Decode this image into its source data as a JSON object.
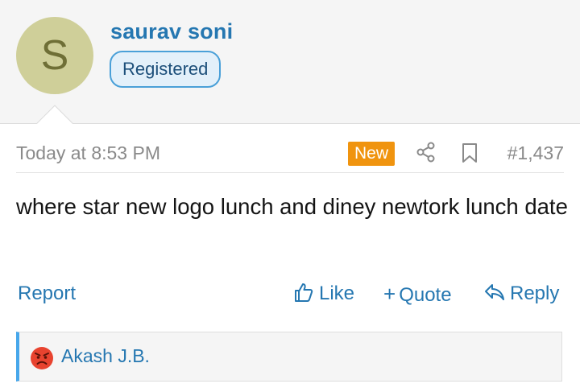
{
  "user": {
    "avatar_letter": "S",
    "name": "saurav soni",
    "role": "Registered"
  },
  "post": {
    "date": "Today at 8:53 PM",
    "new_badge": "New",
    "number": "#1,437",
    "body": "where star new logo lunch and diney newtork lunch date",
    "icons": [
      "share-icon",
      "bookmark-icon"
    ]
  },
  "actions": {
    "report": "Report",
    "like": "Like",
    "quote": "Quote",
    "reply": "Reply"
  },
  "reactions": {
    "icon": "angry-face-icon",
    "user": "Akash J.B."
  },
  "colors": {
    "link": "#2577b1",
    "new_badge": "#f0940f",
    "avatar_bg": "#cfcf99",
    "reaction_accent": "#47a7eb"
  }
}
